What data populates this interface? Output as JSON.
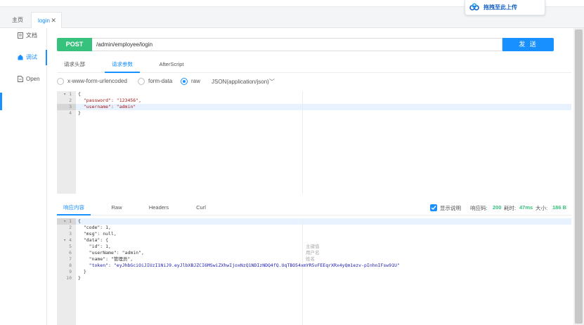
{
  "tabs": {
    "home": "主页",
    "login": "login"
  },
  "upload": {
    "label": "拖拽至此上传"
  },
  "sidebar": {
    "items": [
      {
        "label": "文档",
        "icon": "document-icon"
      },
      {
        "label": "调试",
        "icon": "home-icon"
      },
      {
        "label": "Open",
        "icon": "file-icon"
      }
    ]
  },
  "request": {
    "method": "POST",
    "url": "/admin/employee/login",
    "send_label": "发 送",
    "tabs": [
      "请求头部",
      "请求参数",
      "AfterScript"
    ],
    "active_tab": "请求参数",
    "body_types": [
      "x-www-form-urlencoded",
      "form-data",
      "raw"
    ],
    "selected_body_type": "raw",
    "content_type": "JSON(application/json)",
    "body_lines": [
      {
        "n": "1",
        "text": "{"
      },
      {
        "n": "2",
        "text": "  \"password\": \"123456\","
      },
      {
        "n": "3",
        "text": "  \"username\": \"admin\""
      },
      {
        "n": "4",
        "text": "}"
      }
    ]
  },
  "response": {
    "tabs": [
      "响应内容",
      "Raw",
      "Headers",
      "Curl"
    ],
    "active_tab": "响应内容",
    "show_desc_label": "显示说明",
    "show_desc_checked": true,
    "status_label": "响应码:",
    "status_value": "200",
    "time_label": "耗时:",
    "time_value": "47ms",
    "size_label": "大小:",
    "size_value": "186 B",
    "body_lines": [
      {
        "n": "1",
        "text": "{"
      },
      {
        "n": "2",
        "text": "  \"code\": 1,"
      },
      {
        "n": "3",
        "text": "  \"msg\": null,"
      },
      {
        "n": "4",
        "text": "  \"data\": {"
      },
      {
        "n": "5",
        "text": "    \"id\": 1,"
      },
      {
        "n": "6",
        "text": "    \"userName\": \"admin\","
      },
      {
        "n": "7",
        "text": "    \"name\": \"管理员\","
      },
      {
        "n": "8",
        "text": "    \"token\": \"eyJhbGciOiJIUzI1NiJ9.eyJlbXBJZCI6MSwiZXhwIjoxNzQ1NDIzNDQ4fQ.UqTBO54xmYR5vFEEqrXRx4yQm1ezv-pInhnIFsw91U\""
      },
      {
        "n": "9",
        "text": "  }"
      },
      {
        "n": "10",
        "text": "}"
      }
    ],
    "descriptions": [
      "主键值",
      "用户名",
      "姓名"
    ]
  },
  "colors": {
    "accent": "#1890ff",
    "post": "#36c27c"
  }
}
